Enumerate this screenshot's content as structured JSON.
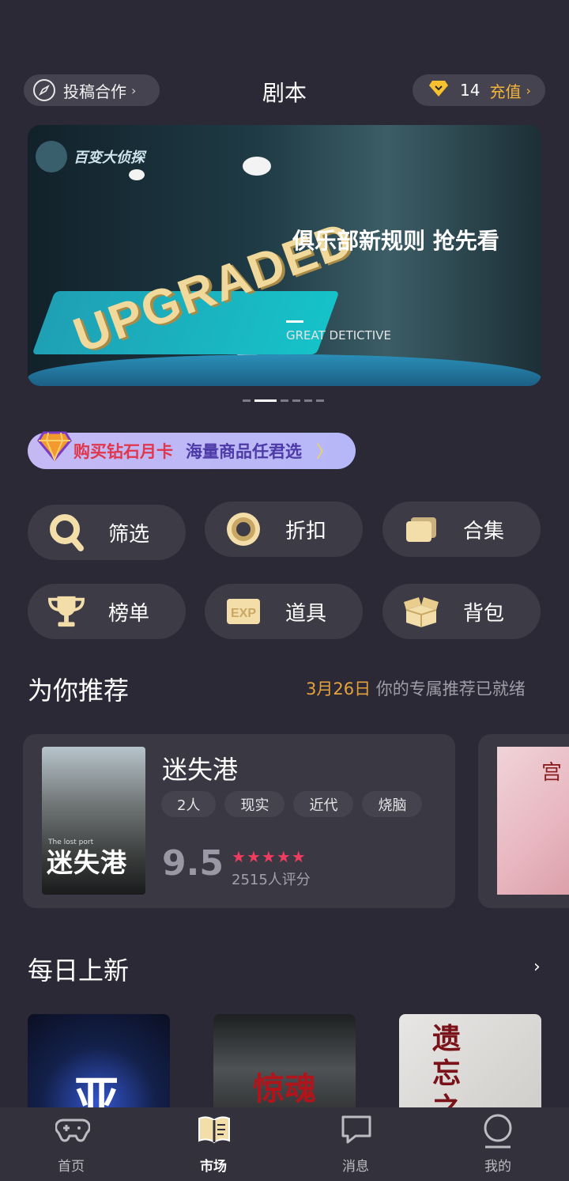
{
  "header": {
    "contribute_label": "投稿合作",
    "title": "剧本",
    "diamond_count": "14",
    "recharge_label": "充值"
  },
  "banner": {
    "logo_text": "百变大侦探",
    "art_word": "UPGRADED",
    "slogan": "俱乐部新规则 抢先看",
    "subtitle": "GREAT DETICTIVE",
    "page_count": 6,
    "active_page": 1
  },
  "promo": {
    "part1": "购买钻石月卡",
    "part2": "海量商品任君选"
  },
  "quick_actions": [
    {
      "label": "筛选",
      "icon": "search-icon"
    },
    {
      "label": "折扣",
      "icon": "discount-coin-icon"
    },
    {
      "label": "合集",
      "icon": "collection-icon"
    },
    {
      "label": "榜单",
      "icon": "trophy-icon"
    },
    {
      "label": "道具",
      "icon": "exp-card-icon"
    },
    {
      "label": "背包",
      "icon": "package-icon"
    }
  ],
  "recommend": {
    "title": "为你推荐",
    "date": "3月26日",
    "date_suffix": "你的专属推荐已就绪",
    "items": [
      {
        "name": "迷失港",
        "cover_title": "迷失港",
        "cover_subtitle": "The lost port",
        "tags": [
          "2人",
          "现实",
          "近代",
          "烧脑"
        ],
        "score": "9.5",
        "rating": 5,
        "raters": "2515人评分"
      }
    ],
    "next_cover_title": "宫"
  },
  "daily": {
    "title": "每日上新",
    "items": [
      {
        "cover_text": "亚"
      },
      {
        "cover_text": "惊魂"
      },
      {
        "cover_text": "遗忘之"
      }
    ]
  },
  "tabs": [
    {
      "label": "首页",
      "icon": "gamepad-icon"
    },
    {
      "label": "市场",
      "icon": "book-icon",
      "active": true
    },
    {
      "label": "消息",
      "icon": "message-icon"
    },
    {
      "label": "我的",
      "icon": "profile-icon"
    }
  ],
  "colors": {
    "background": "#2b2935",
    "accent_gold": "#f4b43a",
    "star_red": "#ef3c5f",
    "promo_red": "#e0374c",
    "promo_purple": "#4d3aa8"
  }
}
